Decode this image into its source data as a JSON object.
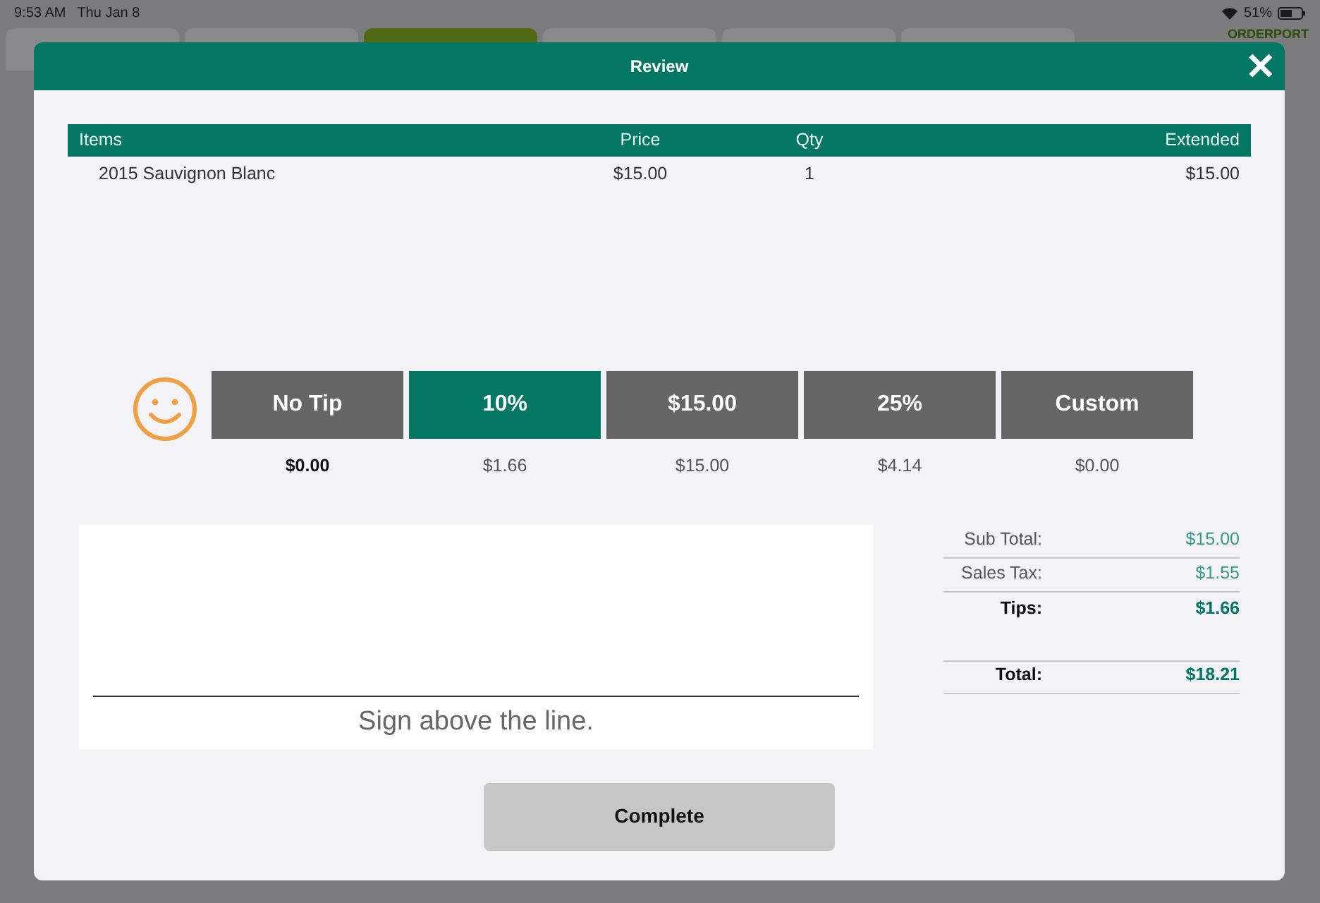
{
  "status_bar": {
    "time": "9:53 AM",
    "date": "Thu Jan 8",
    "battery": "51%"
  },
  "background": {
    "tabs": [
      {
        "selected": false
      },
      {
        "selected": false
      },
      {
        "selected": true
      },
      {
        "selected": false
      },
      {
        "selected": false
      },
      {
        "selected": false
      }
    ],
    "logo": "ORDERPORT"
  },
  "dialog": {
    "title": "Review",
    "close": "✕"
  },
  "table": {
    "columns": [
      "Items",
      "Price",
      "Qty",
      "Extended"
    ],
    "rows": [
      [
        "2015 Sauvignon Blanc",
        "$15.00",
        "1",
        "$15.00"
      ]
    ]
  },
  "tips": [
    {
      "label": "No Tip",
      "amount": "$0.00",
      "selected": false,
      "amount_emphasized": true
    },
    {
      "label": "10%",
      "amount": "$1.66",
      "selected": true,
      "amount_emphasized": false
    },
    {
      "label": "$15.00",
      "amount": "$15.00",
      "selected": false,
      "amount_emphasized": false
    },
    {
      "label": "25%",
      "amount": "$4.14",
      "selected": false,
      "amount_emphasized": false
    },
    {
      "label": "Custom",
      "amount": "$0.00",
      "selected": false,
      "amount_emphasized": false
    }
  ],
  "signature": {
    "caption": "Sign above the line."
  },
  "summary": [
    {
      "label": "Sub Total:",
      "value": "$15.00",
      "kind": "plain"
    },
    {
      "label": "Sales Tax:",
      "value": "$1.55",
      "kind": "plain"
    },
    {
      "label": "Tips:",
      "value": "$1.66",
      "kind": "strong"
    },
    {
      "label": "Total:",
      "value": "$18.21",
      "kind": "total"
    }
  ],
  "complete_button": "Complete"
}
